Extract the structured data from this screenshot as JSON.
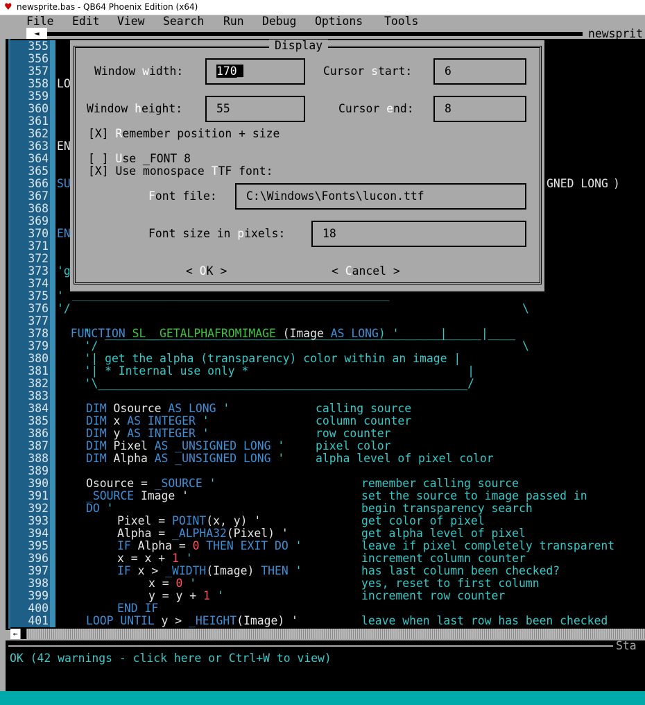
{
  "window": {
    "title": "newsprite.bas - QB64 Phoenix Edition (x64)"
  },
  "menu": [
    "File",
    "Edit",
    "View",
    "Search",
    "Run",
    "Debug",
    "Options",
    "Tools"
  ],
  "tab": {
    "arrow": "◄",
    "name": "newsprit"
  },
  "editor": {
    "line_numbers": [
      "355",
      "356",
      "357",
      "358",
      "359",
      "360",
      "361",
      "362",
      "363",
      "364",
      "365",
      "366",
      "367",
      "368",
      "369",
      "370",
      "371",
      "372",
      "373",
      "374",
      "375",
      "376",
      "377",
      "378",
      "379",
      "380",
      "381",
      "382",
      "383",
      "384",
      "385",
      "386",
      "387",
      "388",
      "389",
      "390",
      "391",
      "392",
      "393",
      "394",
      "395",
      "396",
      "397",
      "398",
      "399",
      "400",
      "401"
    ],
    "partial": {
      "l358": "LO",
      "l363": "EN",
      "l366a": "SU",
      "l366b": "GNED LONG",
      "l366c": ")",
      "l370": "EN",
      "l373": "'g",
      "l375": "'",
      "l376": "'/"
    },
    "l377": {
      "kw": "FUNCTION",
      "fn": "SL__GETALPHAFROMIMAGE",
      "p1": " (Image ",
      "as": "AS",
      "lng": " LONG",
      "p2": ") '",
      "box": "      |"
    },
    "box": {
      "top1": "____________________________________________________________________",
      "l376box": "                                                                    \\",
      "l378": "    '  _______________________________________________________|____",
      "l379": "    '/                                                              \\",
      "l380": "    '| get the alpha (transparency) color within an image |",
      "l381": "    '| * Internal use only *                                |",
      "l382": "    '\\______________________________________________________/"
    },
    "dims": [
      {
        "kw": "DIM",
        "name": " Osource ",
        "as": "AS",
        "type": " LONG",
        "q": " '",
        "cm": "calling source"
      },
      {
        "kw": "DIM",
        "name": " x ",
        "as": "AS",
        "type": " INTEGER",
        "q": " '",
        "cm": "column counter"
      },
      {
        "kw": "DIM",
        "name": " y ",
        "as": "AS",
        "type": " INTEGER",
        "q": " '",
        "cm": "row counter"
      },
      {
        "kw": "DIM",
        "name": " Pixel ",
        "as": "AS",
        "type": " _UNSIGNED LONG",
        "q": " '",
        "cm": "pixel color"
      },
      {
        "kw": "DIM",
        "name": " Alpha ",
        "as": "AS",
        "type": " _UNSIGNED LONG",
        "q": " '",
        "cm": "alpha level of pixel color"
      }
    ],
    "body": {
      "l390a": "Osource = ",
      "l390b": "_SOURCE",
      "l390c": " '",
      "l390cm": "remember calling source",
      "l391a": "_SOURCE",
      "l391b": " Image '",
      "l391cm": "set the source to image passed in",
      "l392a": "DO",
      "l392b": " '",
      "l392cm": "begin transparency search",
      "l393a": "Pixel = ",
      "l393b": "POINT",
      "l393c": "(x, y) '",
      "l393cm": "get color of pixel",
      "l394a": "Alpha = ",
      "l394b": "_ALPHA32",
      "l394c": "(Pixel) '",
      "l394cm": "get alpha level of pixel",
      "l395a": "IF",
      "l395b": " Alpha = ",
      "l395c": "0",
      "l395d": " THEN EXIT DO",
      "l395e": " '",
      "l395cm": "leave if pixel completely transparent",
      "l396a": "x = x + ",
      "l396b": "1",
      "l396c": " '",
      "l396cm": "increment column counter",
      "l397a": "IF",
      "l397b": " x > ",
      "l397c": "_WIDTH",
      "l397d": "(Image) ",
      "l397e": "THEN",
      "l397f": " '",
      "l397cm": "has last column been checked?",
      "l398a": "x = ",
      "l398b": "0",
      "l398c": " '",
      "l398cm": "yes, reset to first column",
      "l399a": "y = y + ",
      "l399b": "1",
      "l399c": " '",
      "l399cm": "increment row counter",
      "l400a": "END IF",
      "l401a": "LOOP UNTIL",
      "l401b": " y > ",
      "l401c": "_HEIGHT",
      "l401d": "(Image) '",
      "l401cm": "leave when last row has been checked"
    }
  },
  "status": {
    "label": "Sta",
    "message": "OK (42 warnings - click here or Ctrl+W to view)"
  },
  "dialog": {
    "title": "Display",
    "window_width": {
      "pre": "Window ",
      "hk": "w",
      "post": "idth:",
      "value": "170",
      "cursor": "_"
    },
    "window_height": {
      "pre": "Window ",
      "hk": "h",
      "post": "eight:",
      "value": "55"
    },
    "cursor_start": {
      "pre": "Cursor ",
      "hk": "s",
      "post": "tart:",
      "value": "6"
    },
    "cursor_end": {
      "pre": "Cursor ",
      "hk": "e",
      "post": "nd:",
      "value": "8"
    },
    "remember": {
      "box": "[X] ",
      "hk": "R",
      "post": "emember position + size"
    },
    "use_font8": {
      "box": "[ ] ",
      "hk": "U",
      "post": "se _FONT 8"
    },
    "use_ttf": {
      "box": "[X] ",
      "pre": "Use monospace ",
      "hk": "T",
      "post": "TF font:"
    },
    "font_file": {
      "hk": "F",
      "post": "ont file:",
      "value": "C:\\Windows\\Fonts\\lucon.ttf"
    },
    "font_size": {
      "pre": "Font size in ",
      "hk": "p",
      "post": "ixels:",
      "value": "18"
    },
    "ok": {
      "pre": "< ",
      "hk": "O",
      "post": "K >"
    },
    "cancel": {
      "pre": "< ",
      "hk": "C",
      "post": "ancel >"
    }
  }
}
